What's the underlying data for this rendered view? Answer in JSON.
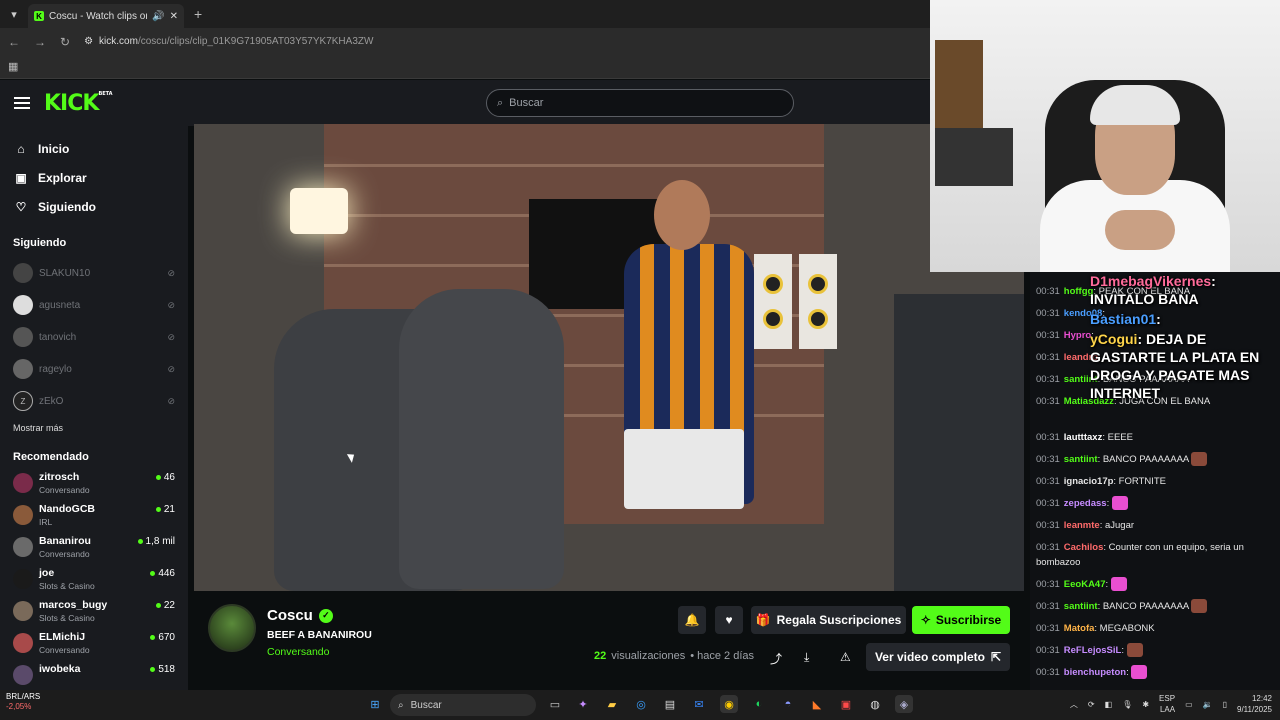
{
  "browser": {
    "tab_title": "Coscu - Watch clips on Kick",
    "url_host": "kick.com",
    "url_path": "/coscu/clips/clip_01K9G71905AT03Y57YK7KHA3ZW"
  },
  "header": {
    "logo": "KICK",
    "logo_badge": "BETA",
    "search_placeholder": "Buscar"
  },
  "sidebar": {
    "nav": [
      {
        "label": "Inicio",
        "icon": "home-icon"
      },
      {
        "label": "Explorar",
        "icon": "compass-icon"
      },
      {
        "label": "Siguiendo",
        "icon": "heart-icon"
      }
    ],
    "following_title": "Siguiendo",
    "following": [
      {
        "name": "SLAKUN10"
      },
      {
        "name": "agusneta"
      },
      {
        "name": "tanovich"
      },
      {
        "name": "rageylo"
      },
      {
        "name": "zEkO"
      }
    ],
    "show_more": "Mostrar más",
    "recommended_title": "Recomendado",
    "recommended": [
      {
        "name": "zitrosch",
        "category": "Conversando",
        "viewers": "46"
      },
      {
        "name": "NandoGCB",
        "category": "IRL",
        "viewers": "21"
      },
      {
        "name": "Bananirou",
        "category": "Conversando",
        "viewers": "1,8 mil"
      },
      {
        "name": "joe",
        "category": "Slots & Casino",
        "viewers": "446"
      },
      {
        "name": "marcos_bugy",
        "category": "Slots & Casino",
        "viewers": "22"
      },
      {
        "name": "ELMichiJ",
        "category": "Conversando",
        "viewers": "670"
      },
      {
        "name": "iwobeka",
        "category": "",
        "viewers": "518"
      }
    ]
  },
  "clip": {
    "channel": "Coscu",
    "title": "BEEF A BANANIROU",
    "category": "Conversando",
    "views_count": "22",
    "views_label": "visualizaciones",
    "time_ago": "• hace 2 días",
    "gift_label": "Regala Suscripciones",
    "subscribe_label": "Suscribirse",
    "full_video_label": "Ver video completo"
  },
  "chat": {
    "alert": {
      "user": "D1mebagVikernes",
      "text": ": INVITALO BANA",
      "user2": "Bastian01",
      "text2": ":",
      "user3": "yCogui",
      "text3": ": DEJA DE GASTARTE LA PLATA EN DROGA Y PAGATE MAS INTERNET"
    },
    "messages": [
      {
        "ts": "00:31",
        "user": "hoffgg",
        "text": ": PEAK CON EL BANA",
        "color": "#53fc18"
      },
      {
        "ts": "00:31",
        "user": "kendo08",
        "text": ":",
        "color": "#4a9eff"
      },
      {
        "ts": "00:31",
        "user": "Hypro",
        "text": ":",
        "color": "#e94fd0"
      },
      {
        "ts": "00:31",
        "user": "leandro",
        "text": ":",
        "color": "#ff6b6b"
      },
      {
        "ts": "00:31",
        "user": "santiint",
        "text": ": BANCO PAAAAAAA",
        "color": "#53fc18"
      },
      {
        "ts": "00:31",
        "user": "Matiasdazz",
        "text": ": JUGA CON EL BANA",
        "color": "#53fc18"
      },
      {
        "ts": "00:31",
        "user": "lautttaxz",
        "text": ": EEEE",
        "color": "#ffffff"
      },
      {
        "ts": "00:31",
        "user": "santiint",
        "text": ": BANCO PAAAAAAA",
        "color": "#53fc18"
      },
      {
        "ts": "00:31",
        "user": "ignacio17p",
        "text": ": FORTNITE",
        "color": "#e6e6e6"
      },
      {
        "ts": "00:31",
        "user": "zepedass",
        "text": ":",
        "color": "#c68cff"
      },
      {
        "ts": "00:31",
        "user": "leanmte",
        "text": ": aJugar",
        "color": "#ff6b6b"
      },
      {
        "ts": "00:31",
        "user": "Cachilos",
        "text": ": Counter con un equipo, seria un bombazoo",
        "color": "#ff6b6b"
      },
      {
        "ts": "00:31",
        "user": "EeoKA47",
        "text": ":",
        "color": "#53fc18"
      },
      {
        "ts": "00:31",
        "user": "santiint",
        "text": ": BANCO PAAAAAAA",
        "color": "#53fc18"
      },
      {
        "ts": "00:31",
        "user": "Matofa",
        "text": ": MEGABONK",
        "color": "#ffb347"
      },
      {
        "ts": "00:31",
        "user": "ReFLejosSiL",
        "text": ":",
        "color": "#c68cff"
      },
      {
        "ts": "00:31",
        "user": "bienchupeton",
        "text": ":",
        "color": "#c68cff"
      }
    ]
  },
  "taskbar": {
    "ticker": "BRL/ARS",
    "ticker_change": "-2,05%",
    "search": "Buscar",
    "lang": "ESP",
    "lang2": "LAA",
    "time": "12:42",
    "date": "9/11/2025"
  }
}
